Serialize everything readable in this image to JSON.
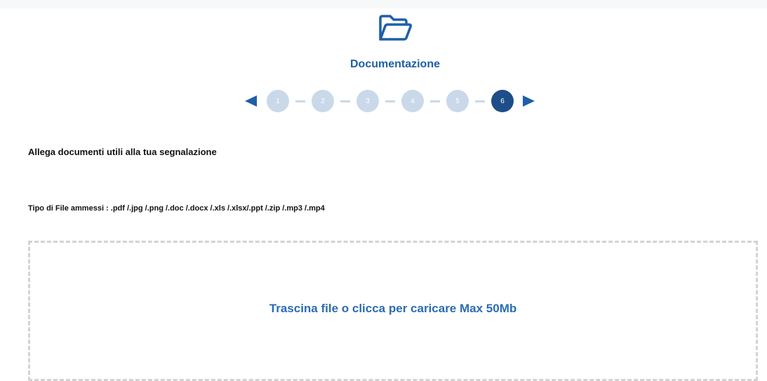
{
  "header": {
    "icon": "folder-open-icon",
    "title": "Documentazione"
  },
  "stepper": {
    "prev_icon": "triangle-left-icon",
    "next_icon": "triangle-right-icon",
    "steps": [
      "1",
      "2",
      "3",
      "4",
      "5",
      "6"
    ],
    "active_step": 6
  },
  "form": {
    "intro": "Allega documenti utili alla tua segnalazione",
    "allowed_types": "Tipo di File ammessi : .pdf /.jpg /.png /.doc /.docx /.xls /.xlsx/.ppt /.zip /.mp3 /.mp4"
  },
  "dropzone": {
    "text": "Trascina file o clicca per caricare Max 50Mb"
  },
  "colors": {
    "accent": "#1f5fa8",
    "step_inactive": "#c9d9ea",
    "step_active": "#1d4e89",
    "dropzone_border": "#d3d3d3"
  }
}
